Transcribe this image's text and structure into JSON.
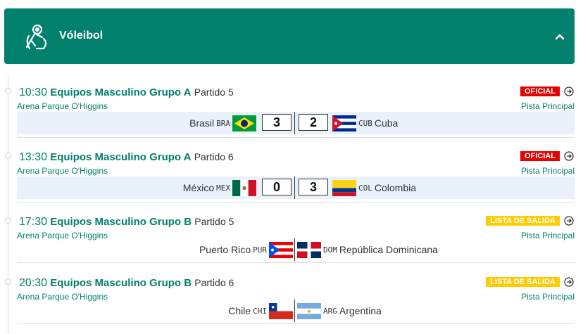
{
  "header": {
    "title": "Vóleibol",
    "icon": "volleyball-icon",
    "collapse_icon": "chevron-up-icon",
    "color": "#00806d"
  },
  "matches": [
    {
      "time": "10:30",
      "event": "Equipos Masculino",
      "group": "Grupo A",
      "game": "Partido 5",
      "status": "OFICIAL",
      "status_color": "#e60000",
      "venue": "Arena Parque O'Higgins",
      "court": "Pista Principal",
      "home": {
        "name": "Brasil",
        "code": "BRA",
        "flag": "flag-brazil",
        "score": "3"
      },
      "away": {
        "name": "Cuba",
        "code": "CUB",
        "flag": "flag-cuba",
        "score": "2"
      }
    },
    {
      "time": "13:30",
      "event": "Equipos Masculino",
      "group": "Grupo A",
      "game": "Partido 6",
      "status": "OFICIAL",
      "status_color": "#e60000",
      "venue": "Arena Parque O'Higgins",
      "court": "Pista Principal",
      "home": {
        "name": "México",
        "code": "MEX",
        "flag": "flag-mexico",
        "score": "0"
      },
      "away": {
        "name": "Colombia",
        "code": "COL",
        "flag": "flag-colombia",
        "score": "3"
      }
    },
    {
      "time": "17:30",
      "event": "Equipos Masculino",
      "group": "Grupo B",
      "game": "Partido 5",
      "status": "LISTA DE SALIDA",
      "status_color": "#ffcc00",
      "venue": "Arena Parque O'Higgins",
      "court": "Pista Principal",
      "home": {
        "name": "Puerto Rico",
        "code": "PUR",
        "flag": "flag-puerto-rico"
      },
      "away": {
        "name": "República Dominicana",
        "code": "DOM",
        "flag": "flag-dominican-republic"
      }
    },
    {
      "time": "20:30",
      "event": "Equipos Masculino",
      "group": "Grupo B",
      "game": "Partido 6",
      "status": "LISTA DE SALIDA",
      "status_color": "#ffcc00",
      "venue": "Arena Parque O'Higgins",
      "court": "Pista Principal",
      "home": {
        "name": "Chile",
        "code": "CHI",
        "flag": "flag-chile"
      },
      "away": {
        "name": "Argentina",
        "code": "ARG",
        "flag": "flag-argentina"
      }
    }
  ]
}
